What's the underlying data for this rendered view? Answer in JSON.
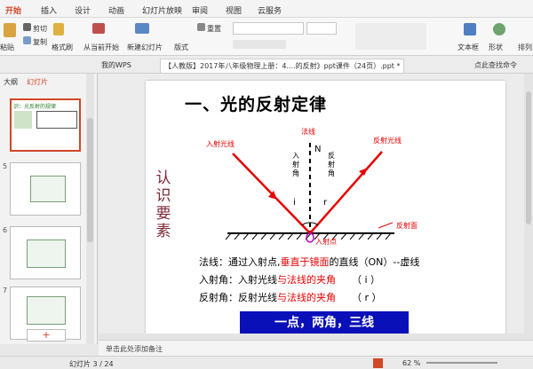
{
  "menu": {
    "tabs": [
      "开始",
      "插入",
      "设计",
      "动画",
      "幻灯片放映",
      "审阅",
      "视图",
      "云服务"
    ]
  },
  "ribbon": {
    "paste": "粘贴",
    "cut": "剪切",
    "copy": "复制",
    "format_painter": "格式刷",
    "from_current": "从当前开始",
    "new_slide": "新建幻灯片",
    "layout": "版式",
    "reset": "重置",
    "textbox": "文本框",
    "shape": "形状",
    "arrange": "排列"
  },
  "tabs": {
    "wps": "我的WPS",
    "document": "【人教版】2017年八年级物理上册：4....的反射》ppt课件（24页）.ppt *",
    "search": "点此查找命令"
  },
  "side": {
    "outline_tab": "大纲",
    "slides_tab": "幻灯片",
    "nums": [
      "5",
      "6",
      "7"
    ],
    "thumb4_title": "识：光反射的规律"
  },
  "slide": {
    "title": "一、光的反射定律",
    "vertical_text": "认识要素",
    "normal_label": "法线",
    "n_label": "N",
    "incident_ray": "入射光线",
    "reflected_ray": "反射光线",
    "incident_angle_v": "入射角",
    "reflection_angle_v": "反射角",
    "i": "i",
    "r": "r",
    "incidence_point": "入射点",
    "reflecting_surface": "反射面",
    "line1_a": "法线：通过入射点,",
    "line1_b": "垂直于镜面",
    "line1_c": "的直线（ON）--虚线",
    "line2_a": "入射角：入射光线",
    "line2_b": "与法线的夹角",
    "line2_c": "（ i ）",
    "line3_a": "反射角：反射光线",
    "line3_b": "与法线的夹角",
    "line3_c": "（ r ）",
    "banner": "一点，两角，三线"
  },
  "notes": {
    "placeholder": "单击此处添加备注"
  },
  "status": {
    "slide_info": "幻灯片 3 / 24",
    "zoom": "62 %"
  }
}
